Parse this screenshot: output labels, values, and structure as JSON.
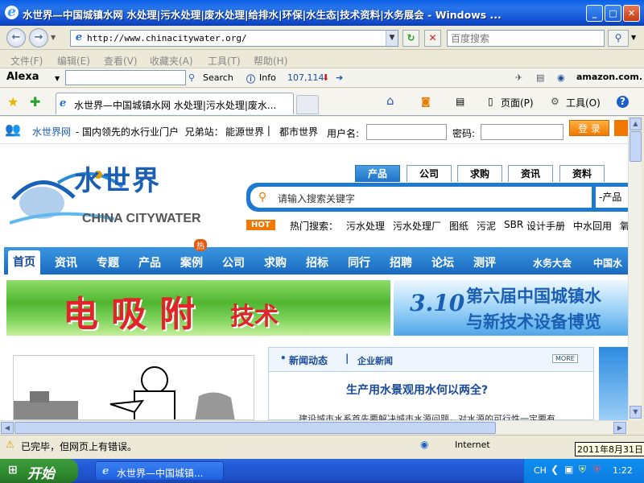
{
  "window": {
    "title": "水世界—中国城镇水网 水处理|污水处理|废水处理|给排水|环保|水生态|技术资料|水务展会 - Windows ...",
    "minimize": "_",
    "maximize": "□",
    "close": "✕"
  },
  "address_bar": {
    "back": "←",
    "forward": "→",
    "url": "http://www.chinacitywater.org/",
    "search_placeholder": "百度搜索"
  },
  "menu": [
    "文件(F)",
    "编辑(E)",
    "查看(V)",
    "收藏夹(A)",
    "工具(T)",
    "帮助(H)"
  ],
  "alexa": {
    "brand": "Alexa",
    "search_label": "Search",
    "info_label": "Info",
    "rank": "107,114",
    "amazon": "amazon.com."
  },
  "tabs": {
    "active_title": "水世界—中国城镇水网 水处理|污水处理|废水...",
    "home_label": "页面(P)",
    "tools_label": "工具(O)",
    "help_label": "?"
  },
  "site": {
    "brand_link": "水世界网",
    "tagline": " - 国内领先的水行业门户  兄弟站：",
    "sister1": "能源世界",
    "sep": " | ",
    "sister2": "都市世界",
    "username_label": "用户名:",
    "password_label": "密码:",
    "login_button": "登 录",
    "logo_cn": "水世界",
    "logo_en": "CHINA CITYWATER",
    "header_tabs": [
      "产品",
      "公司",
      "求购",
      "资讯",
      "资料"
    ],
    "search_placeholder": "请输入搜索关键字",
    "search_category": "-产品",
    "hot_badge": "HOT",
    "hot_label": "热门搜索：",
    "hot_terms": [
      "污水处理",
      "污水处理厂",
      "图纸",
      "污泥",
      "SBR",
      "设计手册",
      "中水回用",
      "氧"
    ],
    "nav": [
      "首页",
      "资讯",
      "专题",
      "产品",
      "案例",
      "公司",
      "求购",
      "招标",
      "同行",
      "招聘",
      "论坛",
      "测评",
      "水务大会",
      "中国水"
    ],
    "nav_hot_badge": "热",
    "banner1_text": "电吸附",
    "banner1_sub": "技术",
    "banner2_logo": "3.10",
    "banner2_line1": "第六届中国城镇水",
    "banner2_line2": "与新技术设备博览",
    "news_tab1": "新闻动态",
    "news_tab2": "企业新闻",
    "news_more": "MORE",
    "news_headline": "生产用水景观用水何以两全?",
    "news_snippet": "建设城市水系首先要解决城市水源问题，对水源的可行性一定要有"
  },
  "status": {
    "text": "已完毕，但网页上有错误。",
    "zone": "Internet",
    "tooltip_date": "2011年8月31日"
  },
  "taskbar": {
    "start": "开始",
    "task_title": "水世界—中国城镇...",
    "lang": "CH",
    "clock": "1:22"
  }
}
